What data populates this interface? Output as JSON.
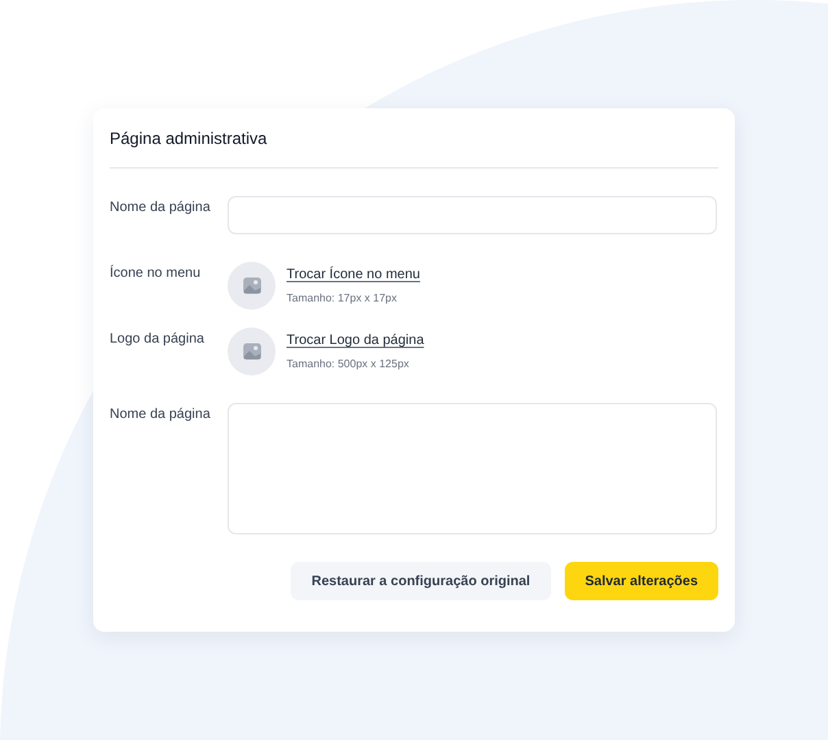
{
  "card": {
    "title": "Página administrativa",
    "rows": [
      {
        "kind": "text",
        "label": "Nome da página"
      },
      {
        "kind": "image",
        "label": "Ícone no menu",
        "link": "Trocar Ícone no menu",
        "hint": "Tamanho: 17px x 17px"
      },
      {
        "kind": "image",
        "label": "Logo da página",
        "link": "Trocar Logo da página",
        "hint": "Tamanho: 500px x 125px"
      },
      {
        "kind": "textarea",
        "label": "Nome da página"
      }
    ],
    "buttons": [
      {
        "kind": "secondary",
        "label": "Restaurar a configuração original"
      },
      {
        "kind": "primary",
        "label": "Salvar alterações"
      }
    ]
  }
}
